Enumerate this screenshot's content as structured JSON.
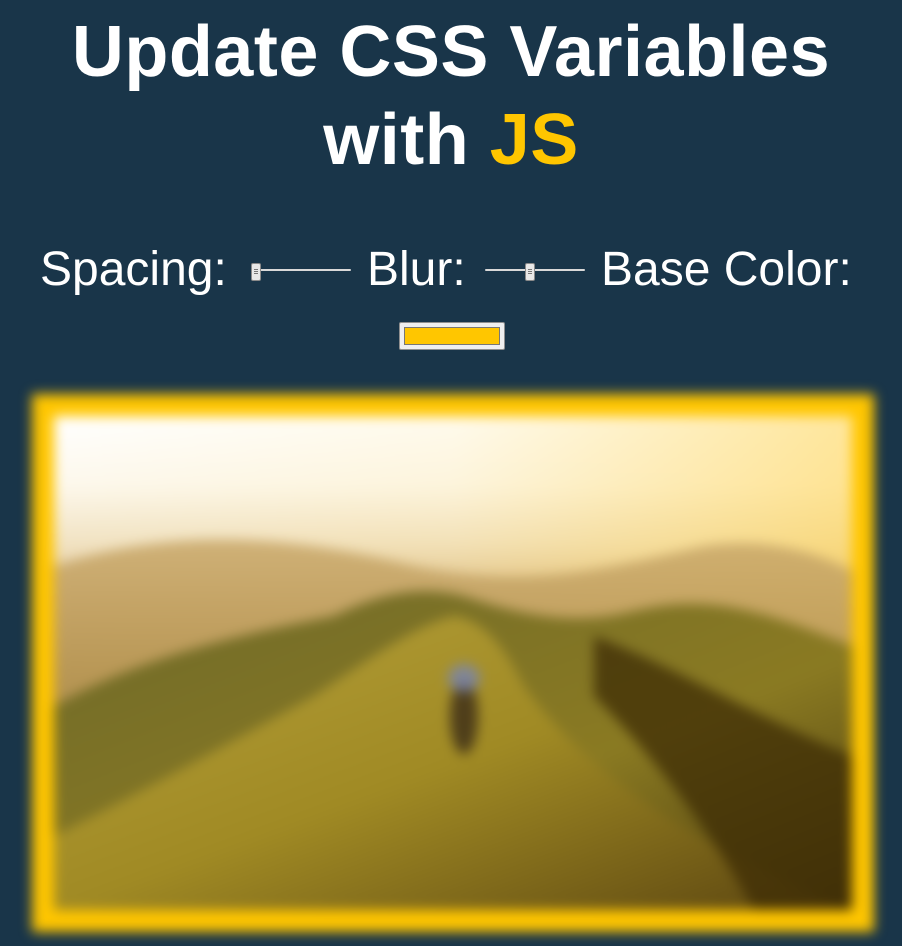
{
  "page": {
    "title_main": "Update CSS Variables",
    "title_with": "with ",
    "title_highlight": "JS"
  },
  "controls": {
    "spacing_label": "Spacing:",
    "blur_label": "Blur:",
    "base_color_label": "Base Color:",
    "spacing_value_fraction": 0.05,
    "blur_value_fraction": 0.45,
    "base_color": "#ffc600"
  },
  "colors": {
    "background": "#193549",
    "accent": "#ffc600"
  },
  "image": {
    "subject": "blurred mountain landscape photo"
  }
}
